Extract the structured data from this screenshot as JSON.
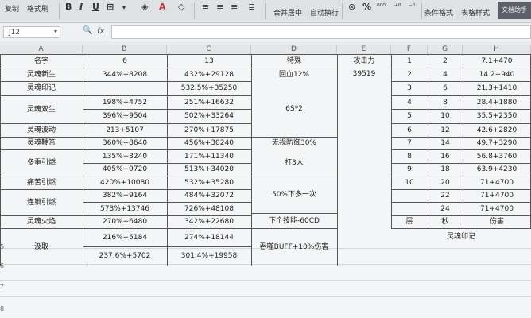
{
  "toolbar": {
    "copy": "复制",
    "format_painter": "格式刷",
    "bold": "B",
    "italic": "I",
    "underline": "U",
    "font_color": "A",
    "merge_center": "合并居中",
    "wrap_text": "自动换行",
    "percent": "%",
    "cond_format": "条件格式",
    "table_style": "表格样式",
    "doc_assist": "文档助手"
  },
  "formula_bar": {
    "cell_ref": "J12",
    "fx": "fx"
  },
  "columns": [
    "A",
    "B",
    "C",
    "D",
    "E",
    "F",
    "G",
    "H"
  ],
  "rows": [
    "5",
    "6",
    "7",
    "8"
  ],
  "left_table": {
    "header": {
      "name": "名字",
      "c6": "6",
      "c13": "13",
      "special": "特殊",
      "attack": "攻击力"
    },
    "attack_value": "39519",
    "skills": [
      {
        "name": "灵魂新生",
        "v6": [
          "344%+8208"
        ],
        "v13": [
          "432%+29128"
        ]
      },
      {
        "name": "灵魂印记",
        "v6": [
          ""
        ],
        "v13": [
          "532.5%+35250"
        ]
      },
      {
        "name": "灵魂双生",
        "v6": [
          "198%+4752",
          "396%+9504"
        ],
        "v13": [
          "251%+16632",
          "502%+33264"
        ]
      },
      {
        "name": "灵魂波动",
        "v6": [
          "213+5107"
        ],
        "v13": [
          "270%+17875"
        ]
      },
      {
        "name": "灵魂鞭笞",
        "v6": [
          "360%+8640"
        ],
        "v13": [
          "456%+30240"
        ]
      },
      {
        "name": "多重引燃",
        "v6": [
          "135%+3240",
          "405%+9720"
        ],
        "v13": [
          "171%+11340",
          "513%+34020"
        ]
      },
      {
        "name": "痛苦引燃",
        "v6": [
          "420%+10080"
        ],
        "v13": [
          "532%+35280"
        ]
      },
      {
        "name": "连锁引燃",
        "v6": [
          "382%+9164",
          "573%+13746"
        ],
        "v13": [
          "484%+32072",
          "726%+48108"
        ]
      },
      {
        "name": "灵魂火焰",
        "v6": [
          "270%+6480"
        ],
        "v13": [
          "342%+22680"
        ]
      },
      {
        "name": "汲取",
        "v6": [
          "216%+5184",
          "237.6%+5702"
        ],
        "v13": [
          "274%+18144",
          "301.4%+19958"
        ]
      }
    ],
    "specials": [
      "回血12%",
      "6S*2",
      "无视防御30%",
      "打3人",
      "50%下多一次",
      "下个技能-60CD",
      "吞噬BUFF+10%伤害"
    ]
  },
  "right_table": {
    "rows": [
      {
        "f": "1",
        "g": "2",
        "h": "7.1+470"
      },
      {
        "f": "2",
        "g": "4",
        "h": "14.2+940"
      },
      {
        "f": "3",
        "g": "6",
        "h": "21.3+1410"
      },
      {
        "f": "4",
        "g": "8",
        "h": "28.4+1880"
      },
      {
        "f": "5",
        "g": "10",
        "h": "35.5+2350"
      },
      {
        "f": "6",
        "g": "12",
        "h": "42.6+2820"
      },
      {
        "f": "7",
        "g": "14",
        "h": "49.7+3290"
      },
      {
        "f": "8",
        "g": "16",
        "h": "56.8+3760"
      },
      {
        "f": "9",
        "g": "18",
        "h": "63.9+4230"
      },
      {
        "f": "10",
        "g": "20",
        "h": "71+4700"
      },
      {
        "f": "",
        "g": "22",
        "h": "71+4700"
      },
      {
        "f": "",
        "g": "24",
        "h": "71+4700"
      }
    ],
    "footer": {
      "f": "层",
      "g": "秒",
      "h": "伤害"
    },
    "caption": "灵魂印记"
  }
}
